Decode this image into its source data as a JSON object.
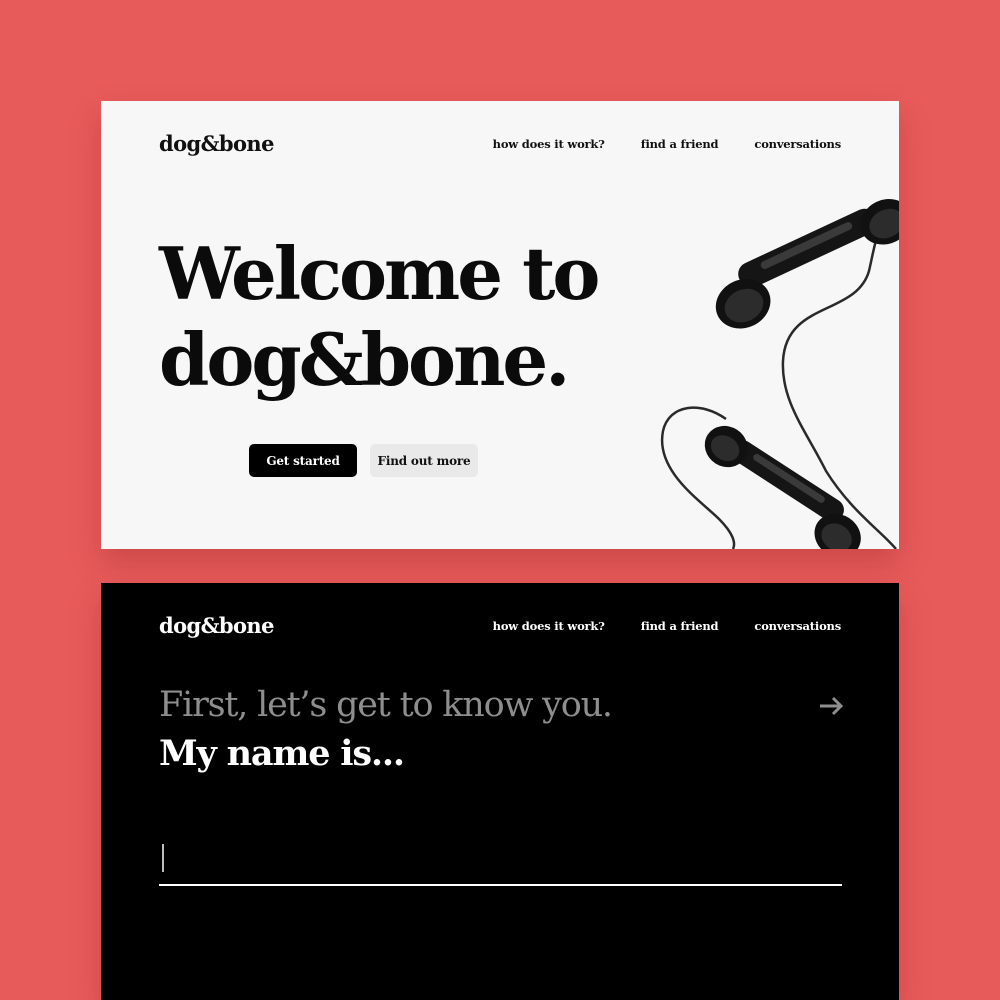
{
  "colors": {
    "background": "#e85b5b",
    "light_card": "#f7f7f7",
    "dark_card": "#000000",
    "primary_button": "#000000",
    "secondary_button": "#e9e9e9",
    "intro_text": "#8e8e8e"
  },
  "landing": {
    "logo": "dog&bone",
    "nav": [
      {
        "label": "how does it work?"
      },
      {
        "label": "find a friend"
      },
      {
        "label": "conversations"
      }
    ],
    "hero": {
      "line1": "Welcome to",
      "line2": "dog&bone."
    },
    "buttons": {
      "primary": "Get started",
      "secondary": "Find out more"
    },
    "image": "telephone-handsets-photo"
  },
  "onboarding": {
    "logo": "dog&bone",
    "nav": [
      {
        "label": "how does it work?"
      },
      {
        "label": "find a friend"
      },
      {
        "label": "conversations"
      }
    ],
    "intro": "First, let’s get to know you.",
    "prompt": "My name is...",
    "name_input_value": "",
    "next_icon": "arrow-right-icon"
  }
}
